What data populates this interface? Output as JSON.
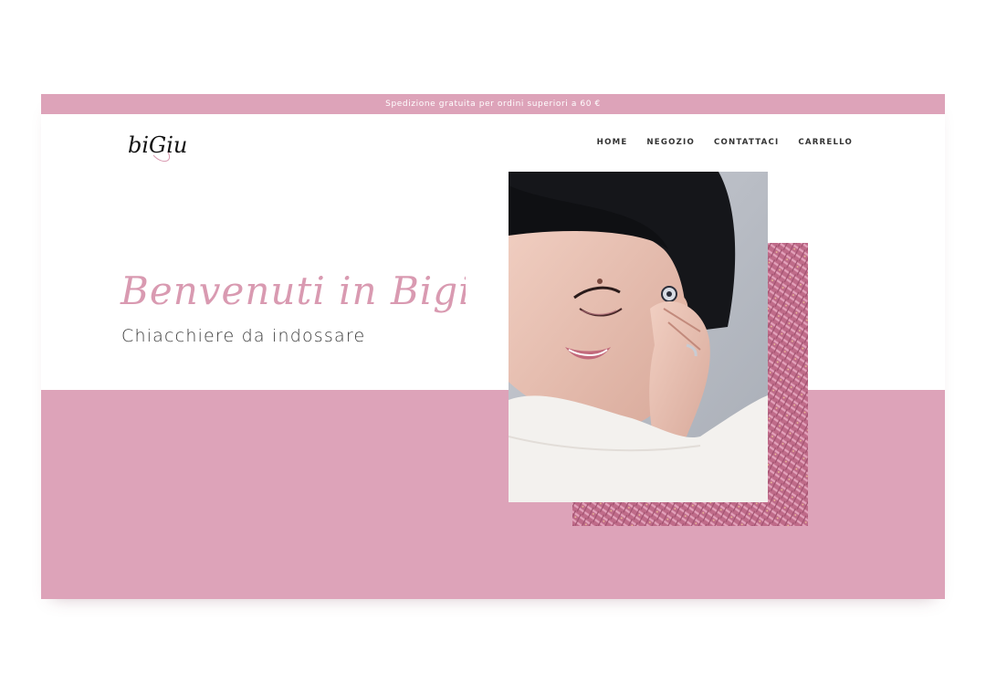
{
  "announcement": {
    "text": "Spedizione gratuita per ordini superiori a 60 €"
  },
  "logo": {
    "text": "biGiu"
  },
  "nav": {
    "items": [
      {
        "label": "HOME"
      },
      {
        "label": "NEGOZIO"
      },
      {
        "label": "CONTATTACI"
      },
      {
        "label": "CARRELLO"
      }
    ]
  },
  "hero": {
    "title": "Benvenuti in Bigiu",
    "subtitle": "Chiacchiere da indossare"
  },
  "colors": {
    "brand_pink": "#dda3b9",
    "title_pink": "#d99ab1",
    "text_dark": "#333333"
  }
}
